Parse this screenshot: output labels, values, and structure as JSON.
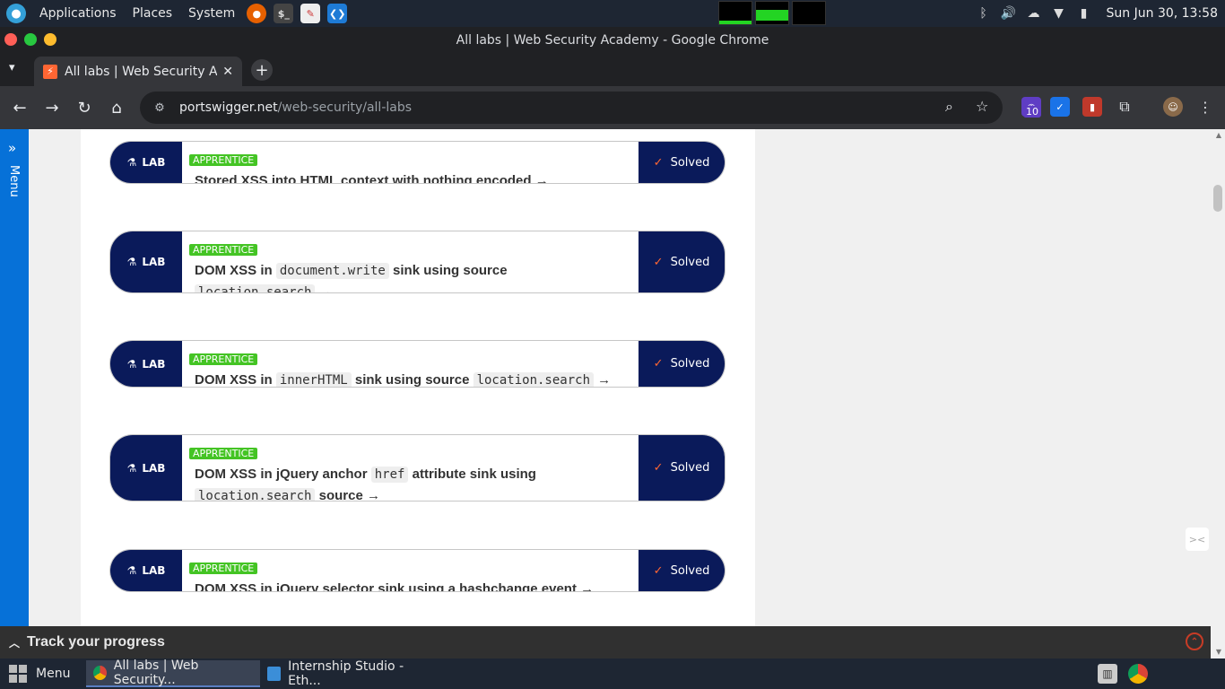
{
  "os_panel": {
    "menus": [
      "Applications",
      "Places",
      "System"
    ],
    "clock": "Sun Jun 30, 13:58"
  },
  "window": {
    "title": "All labs | Web Security Academy - Google Chrome"
  },
  "tab": {
    "title": "All labs | Web Security Ac",
    "close": "✕"
  },
  "omnibox": {
    "host": "portswigger.net",
    "path": "/web-security/all-labs"
  },
  "extensions": {
    "badge": "10"
  },
  "side_menu": {
    "label": "Menu"
  },
  "labs": [
    {
      "tag": "LAB",
      "level": "APPRENTICE",
      "title_parts": [
        {
          "t": "text",
          "v": "Stored XSS into HTML context with nothing encoded"
        }
      ],
      "status": "Solved"
    },
    {
      "tag": "LAB",
      "level": "APPRENTICE",
      "title_parts": [
        {
          "t": "text",
          "v": "DOM XSS in "
        },
        {
          "t": "code",
          "v": "document.write"
        },
        {
          "t": "text",
          "v": " sink using source "
        },
        {
          "t": "code",
          "v": "location.search"
        }
      ],
      "status": "Solved"
    },
    {
      "tag": "LAB",
      "level": "APPRENTICE",
      "title_parts": [
        {
          "t": "text",
          "v": "DOM XSS in "
        },
        {
          "t": "code",
          "v": "innerHTML"
        },
        {
          "t": "text",
          "v": " sink using source "
        },
        {
          "t": "code",
          "v": "location.search"
        }
      ],
      "status": "Solved"
    },
    {
      "tag": "LAB",
      "level": "APPRENTICE",
      "title_parts": [
        {
          "t": "text",
          "v": "DOM XSS in jQuery anchor "
        },
        {
          "t": "code",
          "v": "href"
        },
        {
          "t": "text",
          "v": " attribute sink using "
        },
        {
          "t": "code",
          "v": "location.search"
        },
        {
          "t": "text",
          "v": " source"
        }
      ],
      "status": "Solved"
    },
    {
      "tag": "LAB",
      "level": "APPRENTICE",
      "title_parts": [
        {
          "t": "text",
          "v": "DOM XSS in jQuery selector sink using a hashchange event"
        }
      ],
      "status": "Solved"
    }
  ],
  "progress": {
    "label": "Track your progress"
  },
  "taskbar": {
    "menu_label": "Menu",
    "tasks": [
      "All labs | Web Security...",
      "Internship Studio - Eth..."
    ]
  }
}
